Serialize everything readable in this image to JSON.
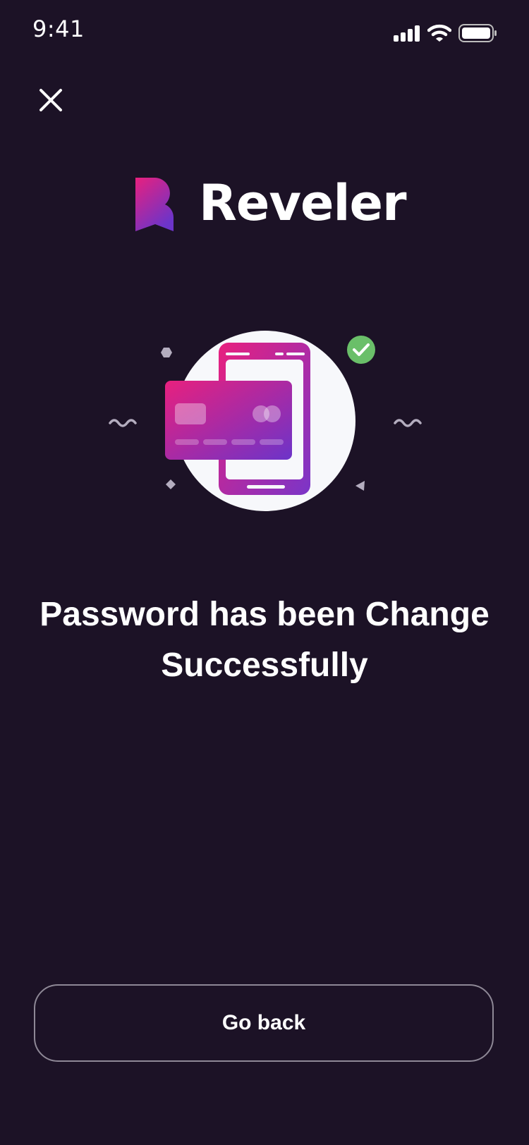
{
  "status_bar": {
    "time": "9:41",
    "icons": [
      "cellular-signal-icon",
      "wifi-icon",
      "battery-icon"
    ]
  },
  "header": {
    "close_icon": "close-icon"
  },
  "brand": {
    "name": "Reveler",
    "logo_icon": "reveler-logo-icon",
    "gradient_colors": [
      "#e8207e",
      "#6c34c9"
    ]
  },
  "illustration": {
    "icon": "phone-card-payment-icon",
    "badge_icon": "check-circle-icon",
    "badge_color": "#6abf69"
  },
  "message": {
    "line1": "Password has been Change",
    "line2": "Successfully"
  },
  "actions": {
    "go_back_label": "Go back"
  },
  "colors": {
    "background": "#1c1226",
    "text": "#ffffff",
    "button_border": "#8e8896"
  }
}
